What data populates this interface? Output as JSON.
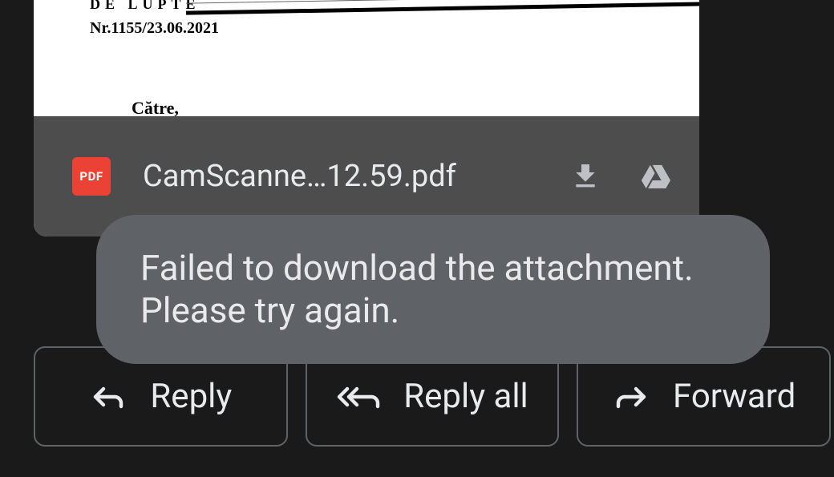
{
  "attachment": {
    "preview": {
      "line1": "DE LUPTE",
      "line2": "Nr.1155/23.06.2021",
      "line3": "Către,"
    },
    "icon_label": "PDF",
    "filename": "CamScanne…12.59.pdf"
  },
  "toast": {
    "message": "Failed to download the attachment. Please try again."
  },
  "actions": {
    "reply": "Reply",
    "reply_all": "Reply all",
    "forward": "Forward"
  }
}
